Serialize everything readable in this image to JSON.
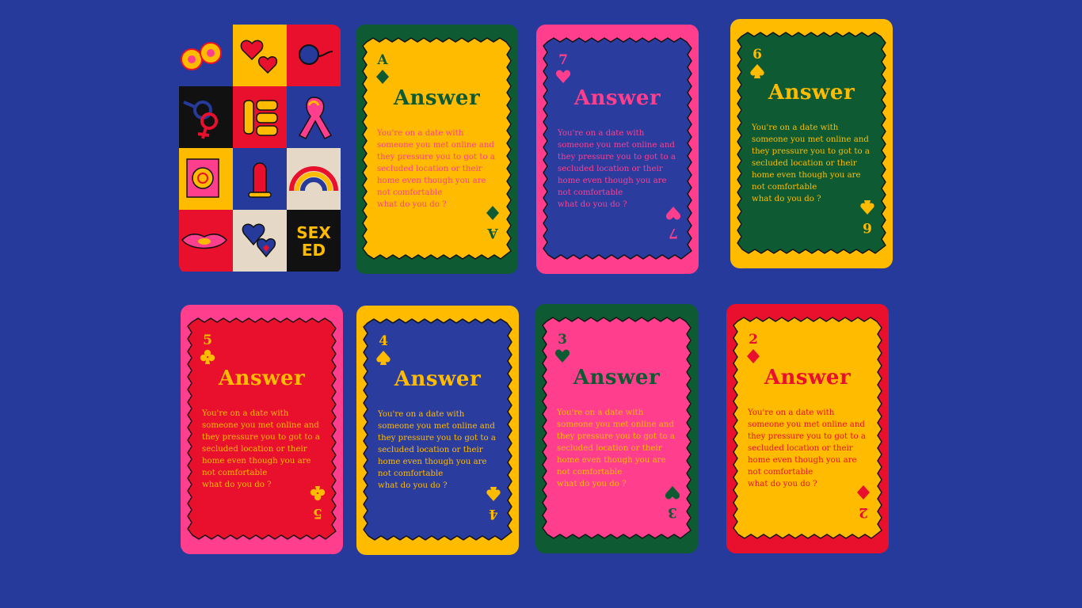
{
  "colors": {
    "background": "#253a9a",
    "yellow": "#ffbb00",
    "pink": "#ff3f8e",
    "green": "#0e5a32",
    "red": "#e8102c",
    "blue": "#2a3c9e",
    "cream": "#e6d8c6",
    "black": "#111111"
  },
  "deck": {
    "icons": [
      "breasts-icon",
      "hearts-icon",
      "symbol-circle-icon",
      "gender-symbols-icon",
      "sex-character-icon",
      "awareness-ribbon-icon",
      "condom-packet-icon",
      "condom-icon",
      "rainbow-icon",
      "lips-icon",
      "heart-pair-icon",
      "sex-ed-logo"
    ],
    "logo_text": "SEX ED"
  },
  "cards": [
    {
      "rank": "A",
      "suit": "diamond",
      "title": "Answer",
      "text": "You're on a date with\nsomeone you met online and\nthey pressure you to got to a\nsecluded location or their\nhome even though you are\nnot comfortable\nwhat do you do ?"
    },
    {
      "rank": "7",
      "suit": "heart",
      "title": "Answer",
      "text": "You're on a date with\nsomeone you met online and\nthey pressure you to got to a\nsecluded location or their\nhome even though you are\nnot comfortable\nwhat do you do ?"
    },
    {
      "rank": "6",
      "suit": "spade",
      "title": "Answer",
      "text": "You're on a date with\nsomeone you met online and\nthey pressure you to got to a\nsecluded location or their\nhome even though you are\nnot comfortable\nwhat do you do ?"
    },
    {
      "rank": "5",
      "suit": "club",
      "title": "Answer",
      "text": "You're on a date with\nsomeone you met online and\nthey pressure you to got to a\nsecluded location or their\nhome even though you are\nnot comfortable\nwhat do you do ?"
    },
    {
      "rank": "4",
      "suit": "spade",
      "title": "Answer",
      "text": "You're on a date with\nsomeone you met online and\nthey pressure you to got to a\nsecluded location or their\nhome even though you are\nnot comfortable\nwhat do you do ?"
    },
    {
      "rank": "3",
      "suit": "heart",
      "title": "Answer",
      "text": "You're on a date with\nsomeone you met online and\nthey pressure you to got to a\nsecluded location or their\nhome even though you are\nnot comfortable\nwhat do you do ?"
    },
    {
      "rank": "2",
      "suit": "diamond",
      "title": "Answer",
      "text": "You're on a date with\nsomeone you met online and\nthey pressure you to got to a\nsecluded location or their\nhome even though you are\nnot comfortable\nwhat do you do ?"
    }
  ]
}
